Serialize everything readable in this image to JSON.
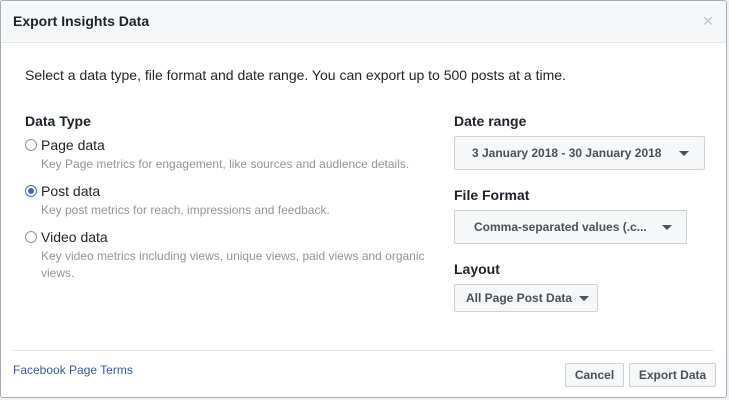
{
  "dialog": {
    "title": "Export Insights Data",
    "close_glyph": "×",
    "intro": "Select a data type, file format and date range. You can export up to 500 posts at a time."
  },
  "data_type": {
    "label": "Data Type",
    "options": [
      {
        "title": "Page data",
        "description": "Key Page metrics for engagement, like sources and audience details.",
        "selected": false
      },
      {
        "title": "Post data",
        "description": "Key post metrics for reach, impressions and feedback.",
        "selected": true
      },
      {
        "title": "Video data",
        "description": "Key video metrics including views, unique views, paid views and organic views.",
        "selected": false
      }
    ]
  },
  "date_range": {
    "label": "Date range",
    "value": "3 January 2018 - 30 January 2018"
  },
  "file_format": {
    "label": "File Format",
    "value": "Comma-separated values (.c..."
  },
  "layout": {
    "label": "Layout",
    "value": "All Page Post Data"
  },
  "footer": {
    "terms_link": "Facebook Page Terms",
    "cancel_label": "Cancel",
    "export_label": "Export Data"
  },
  "colors": {
    "accent": "#4267b2",
    "link": "#365899",
    "muted_text": "#90949c"
  }
}
